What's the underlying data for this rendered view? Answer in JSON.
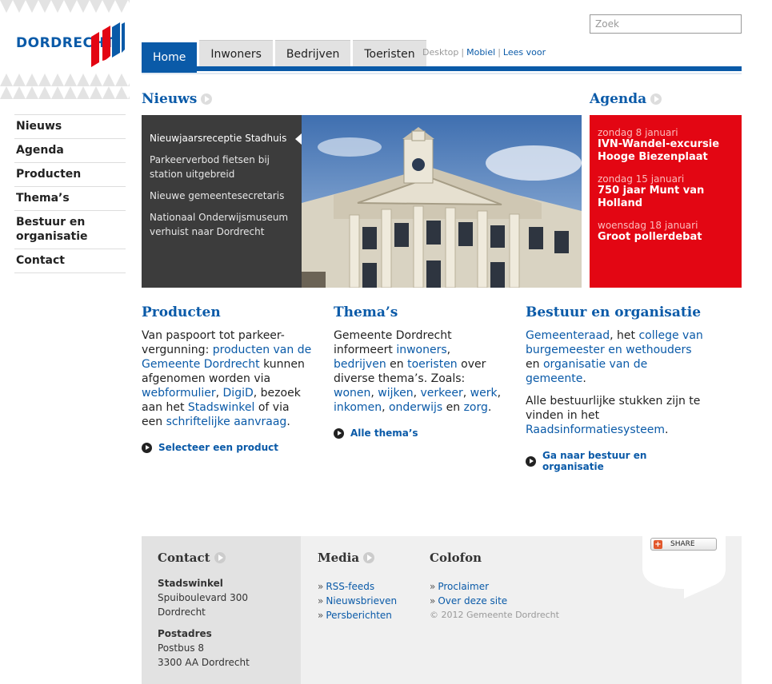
{
  "brand": {
    "logo_text": "DORDRECHT",
    "primary": "#0a5aa8",
    "accent_red": "#e30613"
  },
  "search": {
    "placeholder": "Zoek"
  },
  "tabs": [
    {
      "label": "Home",
      "active": true
    },
    {
      "label": "Inwoners"
    },
    {
      "label": "Bedrijven"
    },
    {
      "label": "Toeristen"
    }
  ],
  "util": {
    "desktop": "Desktop",
    "mobile": "Mobiel",
    "read": "Lees voor"
  },
  "left_nav": [
    "Nieuws",
    "Agenda",
    "Producten",
    "Thema’s",
    "Bestuur en organisatie",
    "Contact"
  ],
  "news": {
    "title": "Nieuws",
    "items": [
      "Nieuwjaarsreceptie Stadhuis",
      "Parkeerverbod fietsen bij station uitgebreid",
      "Nieuwe gemeentesecretaris",
      "Nationaal Onderwijsmuseum verhuist naar Dordrecht"
    ]
  },
  "agenda": {
    "title": "Agenda",
    "items": [
      {
        "date": "zondag 8 januari",
        "title": "IVN-Wandel-excursie Hooge Biezenplaat"
      },
      {
        "date": "zondag 15 januari",
        "title": "750 jaar Munt van Holland"
      },
      {
        "date": "woensdag 18 januari",
        "title": "Groot pollerdebat"
      }
    ]
  },
  "producten": {
    "title": "Producten",
    "t1": "Van paspoort tot parkeer-vergunning: ",
    "l1": "producten van de Gemeente Dordrecht",
    "t2": " kunnen afgenomen worden via ",
    "l2": "webformulier",
    "t3": ", ",
    "l3": "DigiD",
    "t4": ", bezoek aan het ",
    "l4": "Stadswinkel",
    "t5": " of via een ",
    "l5": "schriftelijke aanvraag",
    "t6": ".",
    "cta": "Selecteer een product"
  },
  "themas": {
    "title": "Thema’s",
    "t1": "Gemeente Dordrecht informeert ",
    "l1": "inwoners",
    "t2": ", ",
    "l2": "bedrijven",
    "t3": " en ",
    "l3": "toeristen",
    "t4": " over diverse thema’s. Zoals: ",
    "l4": "wonen",
    "t5": ", ",
    "l5": "wijken",
    "t6": ", ",
    "l6": "verkeer",
    "t7": ", ",
    "l7": "werk",
    "t8": ", ",
    "l8": "inkomen",
    "t9": ", ",
    "l9": "onderwijs",
    "t10": " en ",
    "l10": "zorg",
    "t11": ".",
    "cta": "Alle thema’s"
  },
  "bestuur": {
    "title": "Bestuur en organisatie",
    "l1": "Gemeenteraad",
    "t1": ", het ",
    "l2": "college van burgemeester en wethouders",
    "t2": " en ",
    "l3": "organisatie van de gemeente",
    "t3": ".",
    "p2": "Alle bestuurlijke stukken zijn te vinden in het ",
    "l4": "Raadsinformatiesysteem",
    "t4": ".",
    "cta": "Ga naar bestuur en organisatie"
  },
  "footer": {
    "contact_title": "Contact",
    "stadswinkel_label": "Stadswinkel",
    "stadswinkel_addr1": "Spuiboulevard 300",
    "stadswinkel_addr2": "Dordrecht",
    "postadres_label": "Postadres",
    "postadres_addr1": "Postbus 8",
    "postadres_addr2": "3300 AA Dordrecht",
    "media_title": "Media",
    "media_links": [
      "RSS-feeds",
      "Nieuwsbrieven",
      "Persberichten"
    ],
    "colofon_title": "Colofon",
    "colofon_links": [
      "Proclaimer",
      "Over deze site"
    ],
    "copyright": "© 2012 Gemeente Dordrecht",
    "share_label": "SHARE"
  }
}
